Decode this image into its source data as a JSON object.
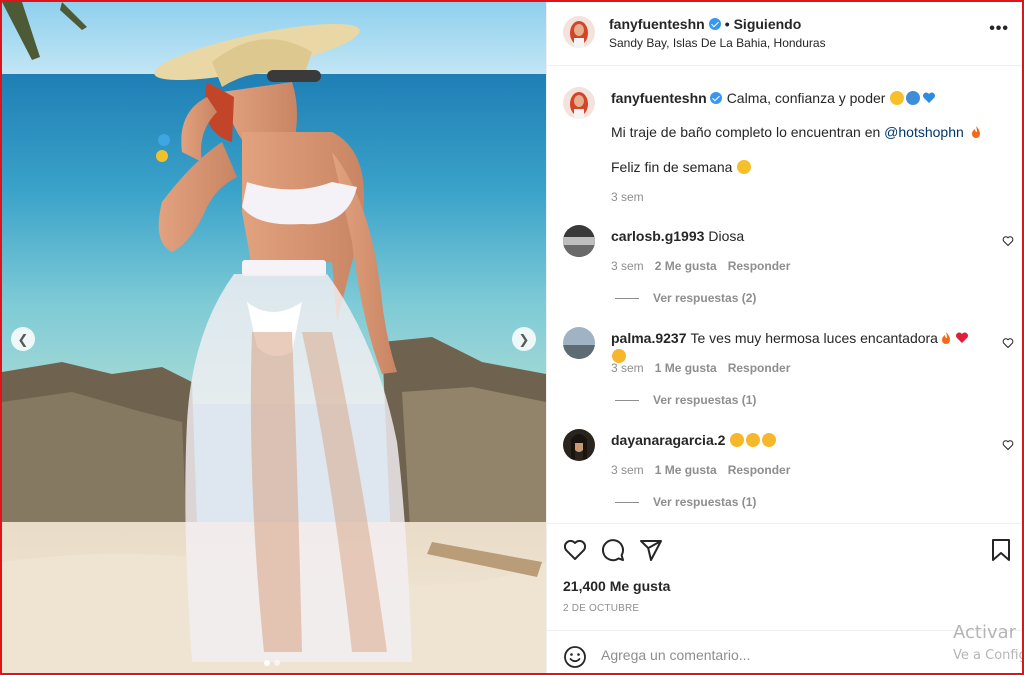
{
  "post": {
    "username": "fanyfuenteshn",
    "verified": true,
    "follow_status": "Siguiendo",
    "location": "Sandy Bay, Islas De La Bahia, Honduras",
    "more_icon": "more-horizontal-icon"
  },
  "caption": {
    "username": "fanyfuenteshn",
    "line1": "Calma, confianza y poder",
    "line1_emojis": [
      "sunglasses-emoji",
      "wave-emoji",
      "blue-heart-emoji"
    ],
    "line2_prefix": "Mi traje de baño completo lo encuentran en",
    "line2_mention": "@hotshophn",
    "line2_emoji": "fire-emoji",
    "line3": "Feliz fin de semana",
    "line3_emoji": "sunglasses-emoji",
    "time": "3 sem"
  },
  "comments": [
    {
      "username": "carlosb.g1993",
      "text": "Diosa",
      "time": "3 sem",
      "likes": "2 Me gusta",
      "reply": "Responder",
      "view_replies": "Ver respuestas (2)"
    },
    {
      "username": "palma.9237",
      "text": "Te ves muy hermosa luces encantadora",
      "emojis": [
        "fire-emoji",
        "red-heart-emoji",
        "star-eyes-emoji"
      ],
      "time": "3 sem",
      "likes": "1 Me gusta",
      "reply": "Responder",
      "view_replies": "Ver respuestas (1)"
    },
    {
      "username": "dayanaragarcia.2",
      "text": "",
      "emojis": [
        "star-eyes-emoji",
        "star-eyes-emoji",
        "star-eyes-emoji"
      ],
      "time": "3 sem",
      "likes": "1 Me gusta",
      "reply": "Responder",
      "view_replies": "Ver respuestas (1)"
    }
  ],
  "actions": {
    "icons": [
      "heart-icon",
      "comment-icon",
      "share-icon",
      "bookmark-icon"
    ],
    "likes": "21,400 Me gusta",
    "date": "2 de octubre"
  },
  "add_comment": {
    "placeholder": "Agrega un comentario...",
    "emoji_icon": "smile-icon"
  },
  "carousel": {
    "prev_icon": "chevron-left-icon",
    "next_icon": "chevron-right-icon",
    "slides": 2,
    "active_slide": 1
  },
  "watermark": {
    "line1": "Activar V",
    "line2": "Ve a Config"
  },
  "colors": {
    "border_frame": "#e0131b",
    "verified": "#3897f0",
    "text": "#262626",
    "secondary": "#8e8e8e",
    "mention": "#00376b"
  }
}
